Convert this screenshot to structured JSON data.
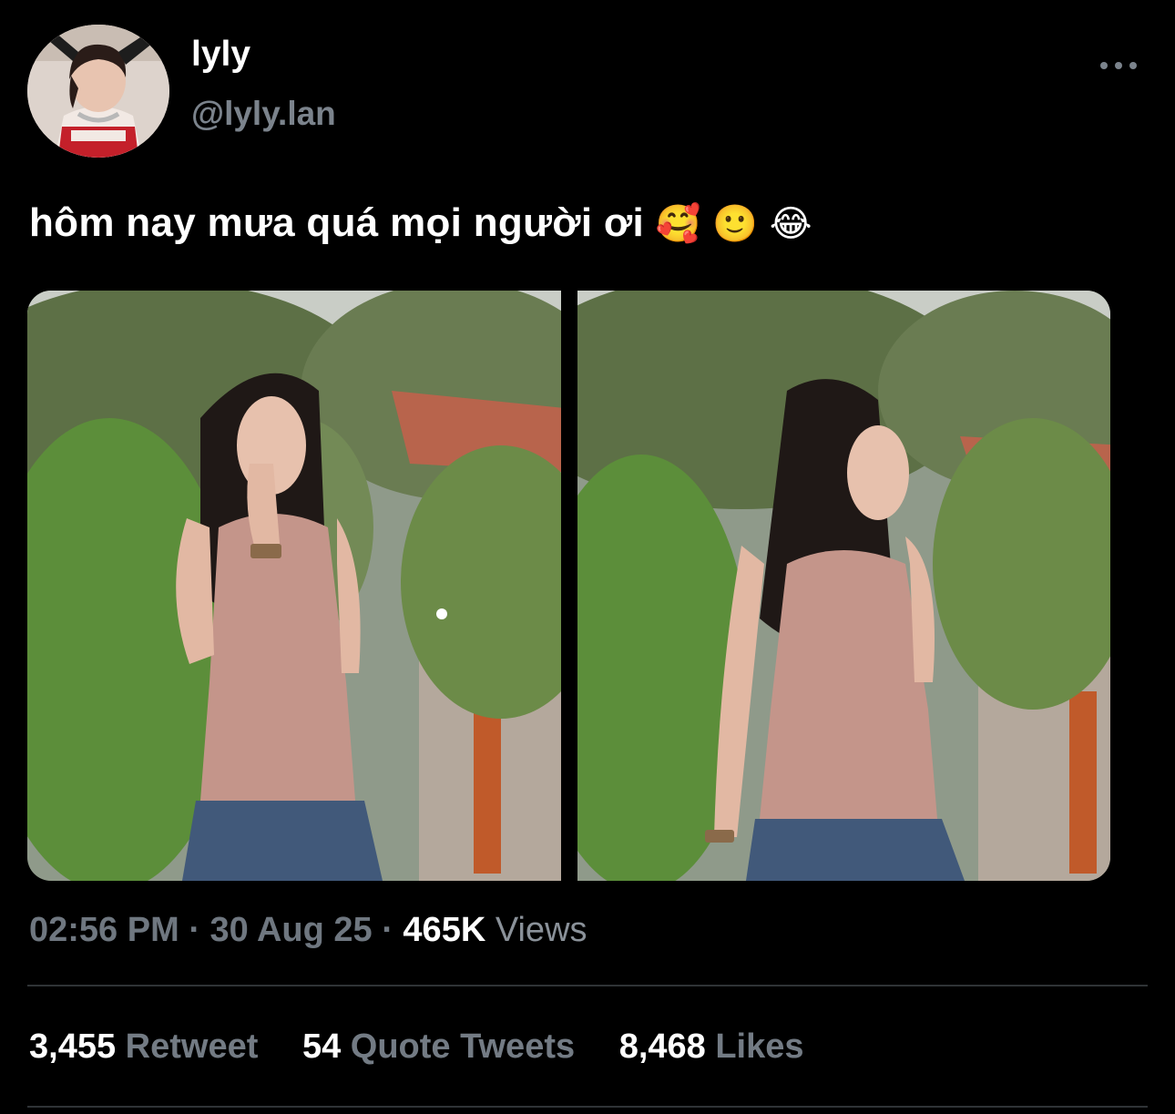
{
  "author": {
    "name": "lyly",
    "handle": "@lyly.lan",
    "avatar_icon": "profile-photo"
  },
  "tweet": {
    "text": "hôm nay mưa quá mọi người ơi",
    "emojis": [
      "🥰",
      "🙂",
      "😂"
    ]
  },
  "media": [
    {
      "description_icon": "photo-woman-pink-top-hand-to-lips"
    },
    {
      "description_icon": "photo-woman-pink-top-looking-side"
    }
  ],
  "meta": {
    "time": "02:56 PM",
    "separator": "·",
    "date": "30 Aug 25",
    "views_count": "465K",
    "views_label": "Views"
  },
  "stats": {
    "retweets_count": "3,455",
    "retweets_label": "Retweet",
    "quotes_count": "54",
    "quotes_label": "Quote Tweets",
    "likes_count": "8,468",
    "likes_label": "Likes"
  },
  "colors": {
    "background": "#000000",
    "text_primary": "#ffffff",
    "text_secondary": "#7b838c",
    "divider": "#2f3336"
  }
}
